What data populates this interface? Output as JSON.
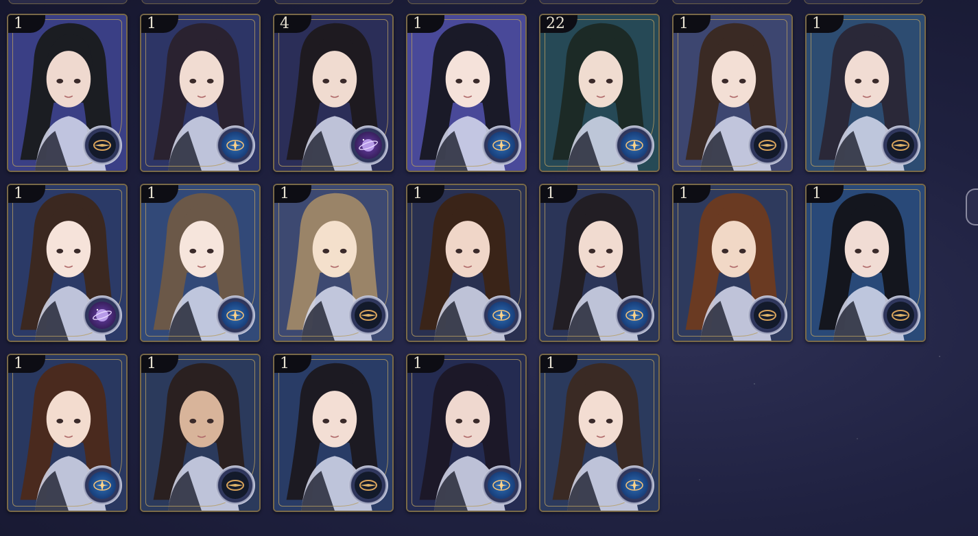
{
  "colors": {
    "card_frame": "#7a6a48",
    "notify_dot": "#e02a32",
    "count_tab_bg": "#0d0d14",
    "count_tab_text": "#e8e2d2"
  },
  "cards": [
    {
      "count": "1",
      "badge": "compass-icon",
      "notify": false,
      "hair": "#1b1d22",
      "skin": "#efd9cf",
      "bg": "#3a3f86"
    },
    {
      "count": "1",
      "badge": "star-blue-icon",
      "notify": true,
      "hair": "#2a2230",
      "skin": "#f1dcd2",
      "bg": "#2d3566"
    },
    {
      "count": "4",
      "badge": "planet-icon",
      "notify": true,
      "hair": "#1e1a20",
      "skin": "#f0dbd0",
      "bg": "#2b2f58"
    },
    {
      "count": "1",
      "badge": "star-blue-icon",
      "notify": false,
      "hair": "#1a1a28",
      "skin": "#f5e2da",
      "bg": "#4a4a9a"
    },
    {
      "count": "22",
      "badge": "star-blue-icon",
      "notify": false,
      "hair": "#1c2a26",
      "skin": "#f0dcd0",
      "bg": "#264a56"
    },
    {
      "count": "1",
      "badge": "compass-icon",
      "notify": false,
      "hair": "#3a2a24",
      "skin": "#f3dfd5",
      "bg": "#3e4670"
    },
    {
      "count": "1",
      "badge": "compass-icon",
      "notify": false,
      "hair": "#2a2838",
      "skin": "#f1dcd3",
      "bg": "#2d4c72"
    },
    {
      "count": "1",
      "badge": "planet-icon",
      "notify": false,
      "hair": "#3b2820",
      "skin": "#f6e3da",
      "bg": "#2c3a68"
    },
    {
      "count": "1",
      "badge": "star-blue-icon",
      "notify": false,
      "hair": "#6b5848",
      "skin": "#f6e5dc",
      "bg": "#324a78"
    },
    {
      "count": "1",
      "badge": "compass-icon",
      "notify": true,
      "hair": "#9a8468",
      "skin": "#f4e0cc",
      "bg": "#3d4a72"
    },
    {
      "count": "1",
      "badge": "star-blue-icon",
      "notify": false,
      "hair": "#3a2418",
      "skin": "#f0d6c8",
      "bg": "#2a3050"
    },
    {
      "count": "1",
      "badge": "star-blue-icon",
      "notify": false,
      "hair": "#221e24",
      "skin": "#f1dbd0",
      "bg": "#2b3658"
    },
    {
      "count": "1",
      "badge": "compass-icon",
      "notify": false,
      "hair": "#6a3a22",
      "skin": "#f1d8c6",
      "bg": "#2e3a5e"
    },
    {
      "count": "1",
      "badge": "compass-icon",
      "notify": false,
      "hair": "#14161e",
      "skin": "#f1dcd4",
      "bg": "#2a4a78"
    },
    {
      "count": "1",
      "badge": "star-blue-icon",
      "notify": false,
      "hair": "#4a2a1e",
      "skin": "#f3dccf",
      "bg": "#2a3860"
    },
    {
      "count": "1",
      "badge": "compass-icon",
      "notify": true,
      "hair": "#2a2020",
      "skin": "#d8b49a",
      "bg": "#2b3a5c"
    },
    {
      "count": "1",
      "badge": "compass-icon",
      "notify": false,
      "hair": "#1c1a22",
      "skin": "#f3ded4",
      "bg": "#2a3c66"
    },
    {
      "count": "1",
      "badge": "star-blue-icon",
      "notify": false,
      "hair": "#1c1828",
      "skin": "#efd8cf",
      "bg": "#252c52"
    },
    {
      "count": "1",
      "badge": "star-blue-icon",
      "notify": true,
      "hair": "#3a2a24",
      "skin": "#f3ddd2",
      "bg": "#2b3a5e"
    }
  ]
}
